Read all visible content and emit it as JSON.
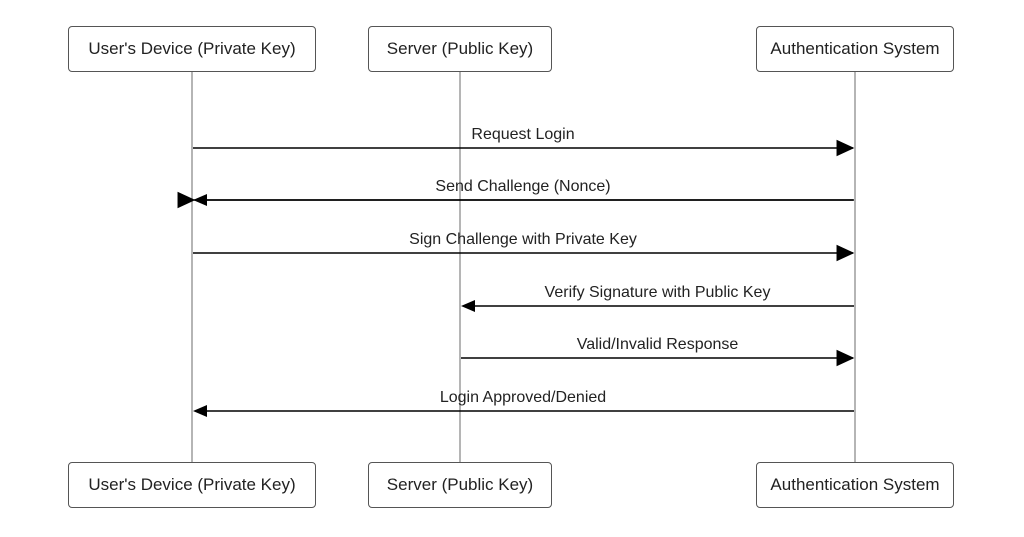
{
  "actors": {
    "user": {
      "label": "User's Device (Private Key)"
    },
    "server": {
      "label": "Server (Public Key)"
    },
    "auth": {
      "label": "Authentication System"
    }
  },
  "messages": {
    "m1": "Request Login",
    "m2": "Send Challenge (Nonce)",
    "m3": "Sign Challenge with Private Key",
    "m4": "Verify Signature with Public Key",
    "m5": "Valid/Invalid Response",
    "m6": "Login Approved/Denied"
  },
  "chart_data": {
    "type": "sequence-diagram",
    "actors": [
      {
        "id": "user",
        "label": "User's Device (Private Key)"
      },
      {
        "id": "server",
        "label": "Server (Public Key)"
      },
      {
        "id": "auth",
        "label": "Authentication System"
      }
    ],
    "messages": [
      {
        "from": "user",
        "to": "auth",
        "label": "Request Login"
      },
      {
        "from": "auth",
        "to": "user",
        "label": "Send Challenge (Nonce)"
      },
      {
        "from": "user",
        "to": "auth",
        "label": "Sign Challenge with Private Key"
      },
      {
        "from": "auth",
        "to": "server",
        "label": "Verify Signature with Public Key"
      },
      {
        "from": "server",
        "to": "auth",
        "label": "Valid/Invalid Response"
      },
      {
        "from": "auth",
        "to": "user",
        "label": "Login Approved/Denied"
      }
    ]
  }
}
